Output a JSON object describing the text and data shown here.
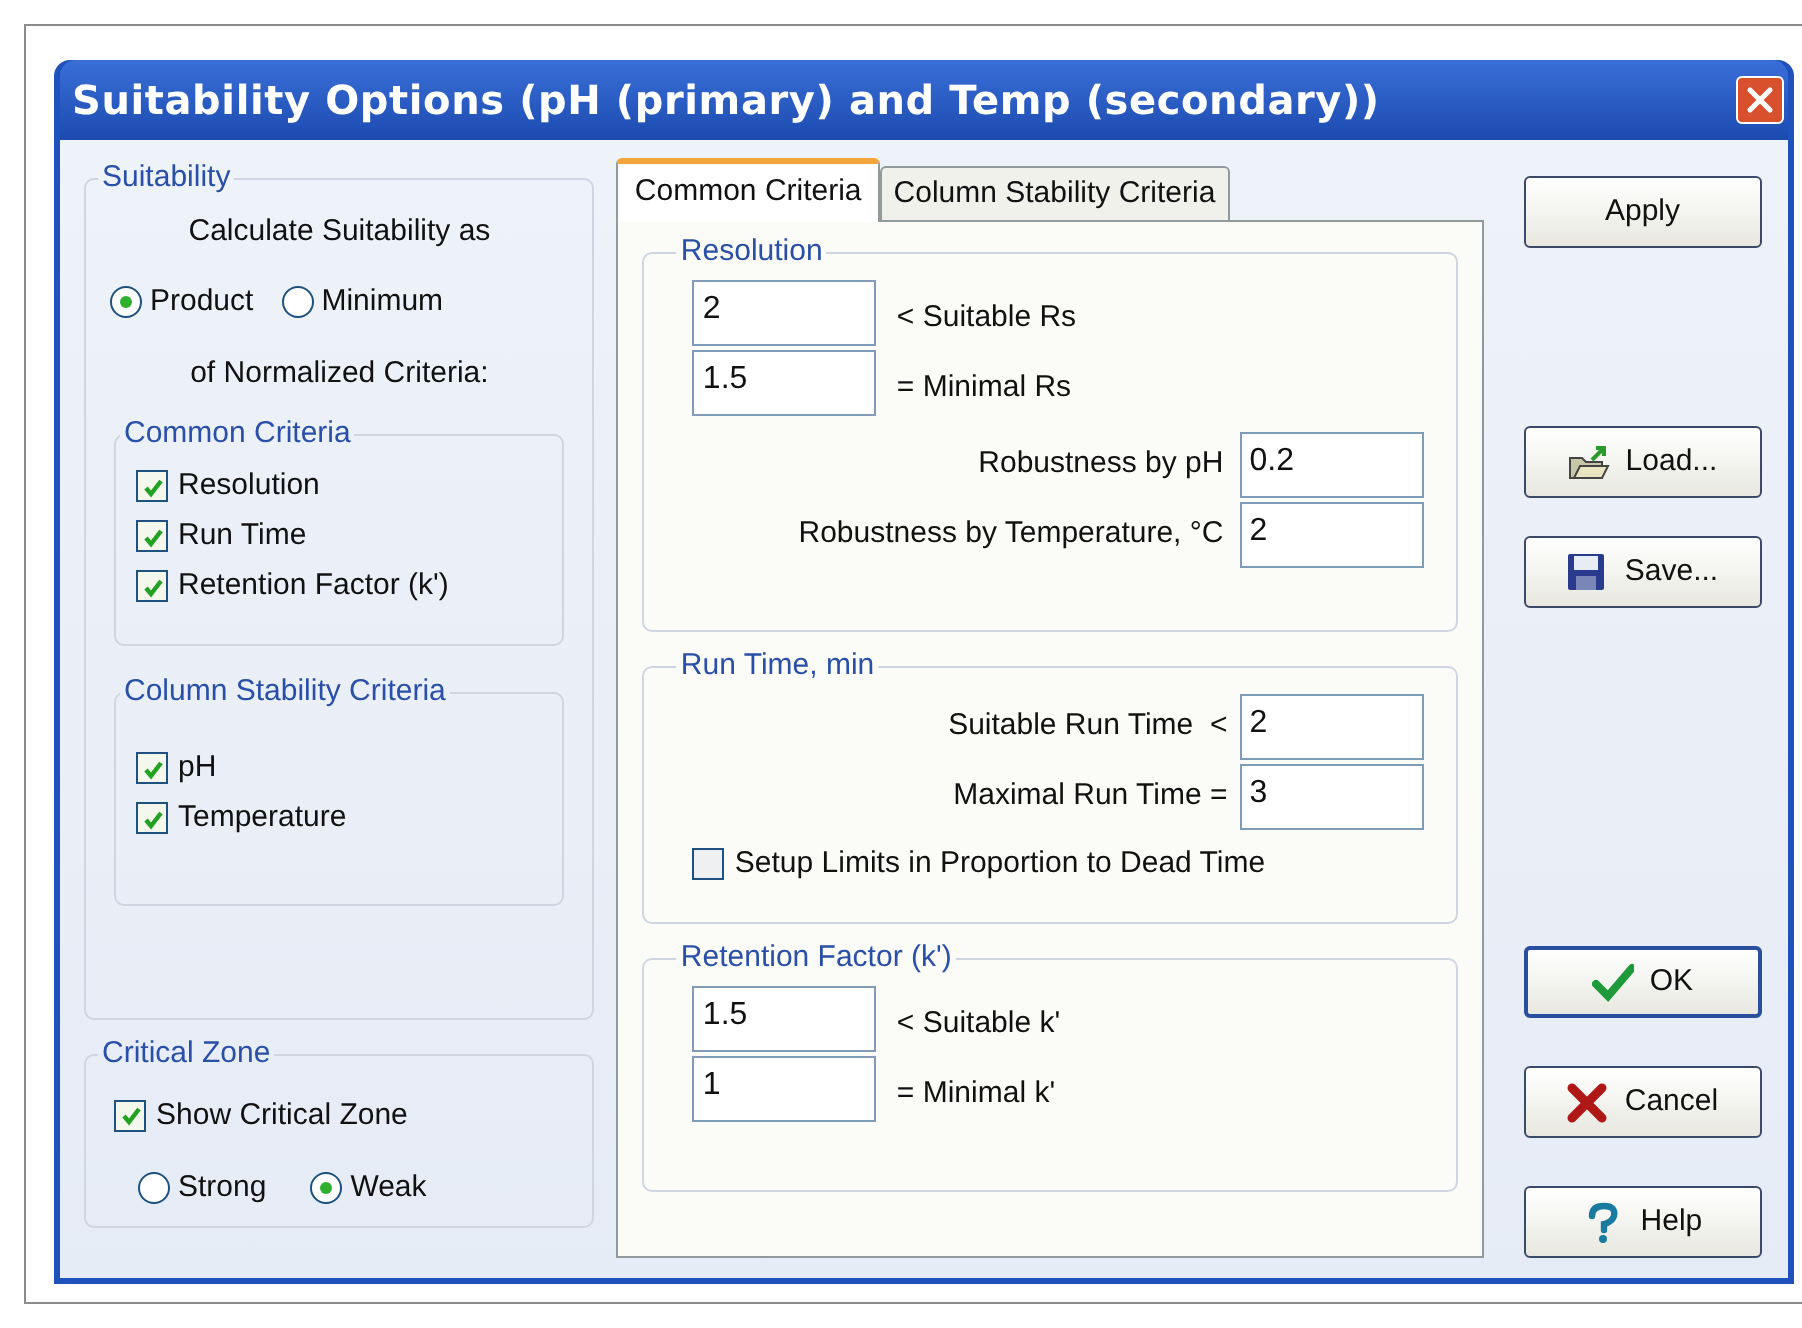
{
  "window": {
    "title": "Suitability Options (pH (primary) and Temp (secondary))"
  },
  "suitability": {
    "title": "Suitability",
    "intro": "Calculate Suitability as",
    "mode_options": [
      {
        "label": "Product",
        "selected": true
      },
      {
        "label": "Minimum",
        "selected": false
      }
    ],
    "outro": "of Normalized Criteria:",
    "common_criteria": {
      "title": "Common Criteria",
      "items": [
        {
          "label": "Resolution",
          "checked": true
        },
        {
          "label": "Run Time",
          "checked": true
        },
        {
          "label": "Retention Factor (k')",
          "checked": true
        }
      ]
    },
    "column_stability_criteria": {
      "title": "Column Stability Criteria",
      "items": [
        {
          "label": "pH",
          "checked": true
        },
        {
          "label": "Temperature",
          "checked": true
        }
      ]
    }
  },
  "critical_zone": {
    "title": "Critical Zone",
    "show": {
      "label": "Show Critical Zone",
      "checked": true
    },
    "options": [
      {
        "label": "Strong",
        "selected": false
      },
      {
        "label": "Weak",
        "selected": true
      }
    ]
  },
  "tabs": [
    {
      "label": "Common Criteria",
      "selected": true
    },
    {
      "label": "Column Stability Criteria",
      "selected": false
    }
  ],
  "resolution": {
    "title": "Resolution",
    "fields": [
      {
        "value": "2",
        "label": "< Suitable Rs"
      },
      {
        "value": "1.5",
        "label": "= Minimal Rs"
      }
    ],
    "robustness": [
      {
        "label": "Robustness by pH",
        "value": "0.2"
      },
      {
        "label": "Robustness by Temperature, °C",
        "value": "2"
      }
    ]
  },
  "run_time": {
    "title": "Run Time, min",
    "fields": [
      {
        "label": "Suitable Run Time  <",
        "value": "2"
      },
      {
        "label": "Maximal Run Time =",
        "value": "3"
      }
    ],
    "proportion": {
      "label": "Setup Limits in Proportion to Dead Time",
      "checked": false
    }
  },
  "retention_factor": {
    "title": "Retention Factor (k')",
    "fields": [
      {
        "value": "1.5",
        "label": "< Suitable k'"
      },
      {
        "value": "1",
        "label": "= Minimal k'"
      }
    ]
  },
  "buttons": [
    [
      {
        "label": "Apply",
        "kind": "plain"
      }
    ],
    [
      {
        "label": "Load...",
        "kind": "load"
      },
      {
        "label": "Save...",
        "kind": "save"
      }
    ],
    [
      {
        "label": "OK",
        "kind": "ok"
      },
      {
        "label": "Cancel",
        "kind": "cancel"
      },
      {
        "label": "Help",
        "kind": "help"
      }
    ]
  ]
}
